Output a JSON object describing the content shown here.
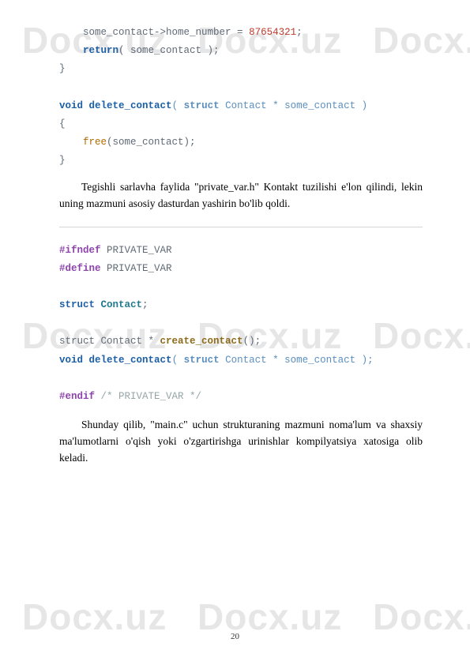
{
  "watermark": "Docx.uz",
  "code1": {
    "line1a": "some_contact->home_number = ",
    "line1num": "87654321",
    "line1b": ";",
    "line2a": "return",
    "line2b": "( some_contact );",
    "line3": "}",
    "line5a": "void",
    "line5b": " ",
    "line5fn": "delete_contact",
    "line5c": "( ",
    "line5d": "struct",
    "line5e": " Contact * some_contact ",
    "line5f": ")",
    "line6": "{",
    "line7a": "free",
    "line7b": "(some_contact);",
    "line8": "}"
  },
  "paragraph1": "Tegishli sarlavha faylida \"private_var.h\" Kontakt tuzilishi e'lon qilindi, lekin uning mazmuni asosiy dasturdan yashirin bo'lib qoldi.",
  "code2": {
    "line1a": "#ifndef",
    "line1b": " PRIVATE_VAR",
    "line2a": "#define",
    "line2b": " PRIVATE_VAR",
    "line4a": "struct",
    "line4b": " ",
    "line4c": "Contact",
    "line4d": ";",
    "line6a": "struct Contact * ",
    "line6fn": "create_contact",
    "line6b": "();",
    "line7a": "void",
    "line7b": " ",
    "line7fn": "delete_contact",
    "line7c": "( ",
    "line7d": "struct",
    "line7e": " Contact * some_contact ",
    "line7f": ");",
    "line9a": "#endif",
    "line9b": " ",
    "line9c": "/* PRIVATE_VAR */"
  },
  "paragraph2": "Shunday qilib, \"main.c\" uchun strukturaning mazmuni noma'lum va shaxsiy ma'lumotlarni o'qish yoki o'zgartirishga urinishlar kompilyatsiya xatosiga olib keladi.",
  "pageNumber": "20"
}
